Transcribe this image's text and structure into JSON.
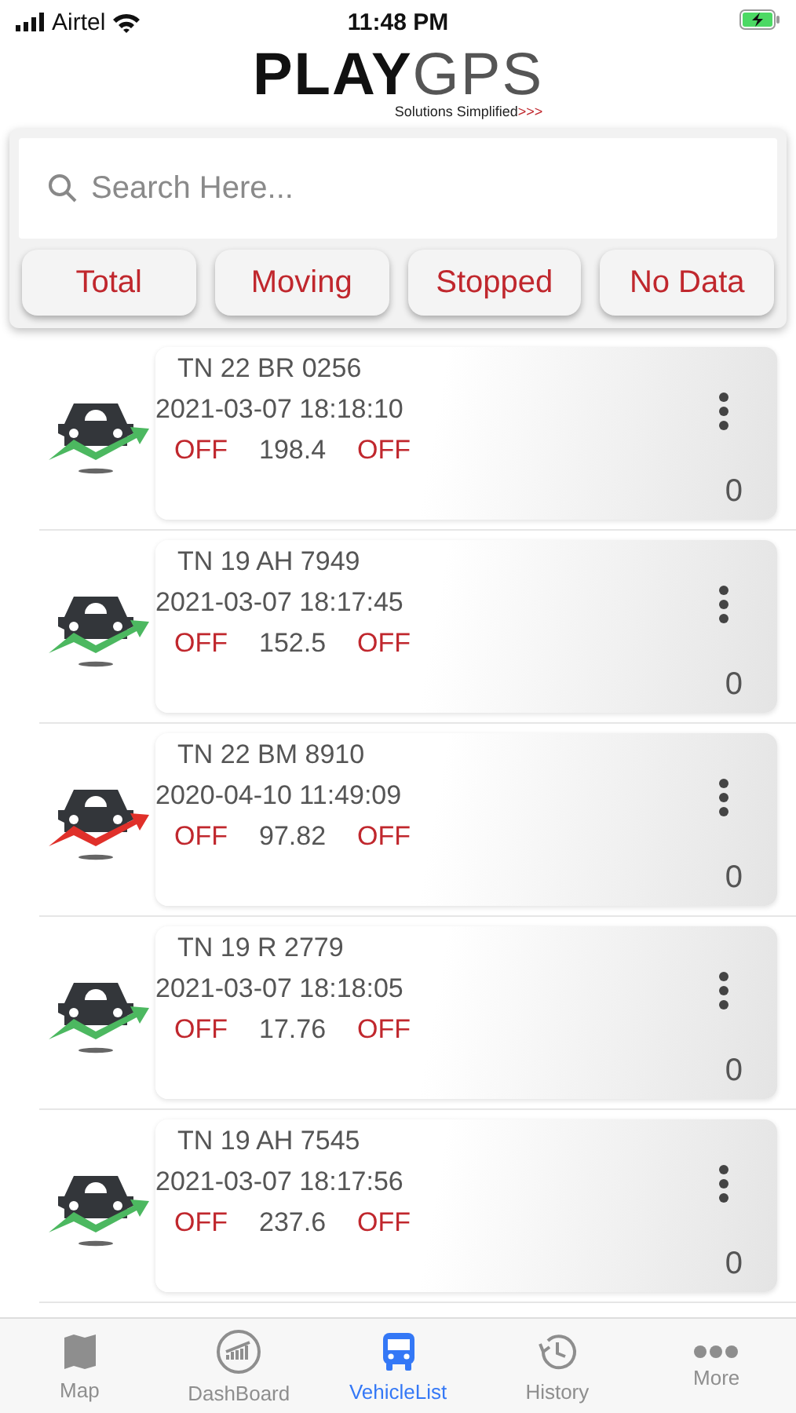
{
  "status_bar": {
    "carrier": "Airtel",
    "time": "11:48 PM"
  },
  "logo": {
    "bold": "PLAY",
    "light": "GPS",
    "tagline": "Solutions Simplified",
    "tagline_mark": ">>>"
  },
  "search": {
    "placeholder": "Search Here..."
  },
  "filters": [
    {
      "label": "Total"
    },
    {
      "label": "Moving"
    },
    {
      "label": "Stopped"
    },
    {
      "label": "No Data"
    }
  ],
  "vehicles": [
    {
      "plate": "TN 22 BR 0256",
      "timestamp": "2021-03-07 18:18:10",
      "ignition": "OFF",
      "odometer": "198.4",
      "ac": "OFF",
      "count": "0",
      "color": "#4cb860"
    },
    {
      "plate": "TN 19 AH 7949",
      "timestamp": "2021-03-07 18:17:45",
      "ignition": "OFF",
      "odometer": "152.5",
      "ac": "OFF",
      "count": "0",
      "color": "#4cb860"
    },
    {
      "plate": "TN 22 BM 8910",
      "timestamp": "2020-04-10 11:49:09",
      "ignition": "OFF",
      "odometer": "97.82",
      "ac": "OFF",
      "count": "0",
      "color": "#e0302a"
    },
    {
      "plate": "TN 19 R 2779",
      "timestamp": "2021-03-07 18:18:05",
      "ignition": "OFF",
      "odometer": "17.76",
      "ac": "OFF",
      "count": "0",
      "color": "#4cb860"
    },
    {
      "plate": "TN 19 AH 7545",
      "timestamp": "2021-03-07 18:17:56",
      "ignition": "OFF",
      "odometer": "237.6",
      "ac": "OFF",
      "count": "0",
      "color": "#4cb860"
    }
  ],
  "tab_bar": [
    {
      "label": "Map",
      "kind": "map",
      "selected": false
    },
    {
      "label": "DashBoard",
      "kind": "dashboard",
      "selected": false
    },
    {
      "label": "VehicleList",
      "kind": "bus",
      "selected": true
    },
    {
      "label": "History",
      "kind": "history",
      "selected": false
    },
    {
      "label": "More",
      "kind": "more",
      "selected": false
    }
  ]
}
